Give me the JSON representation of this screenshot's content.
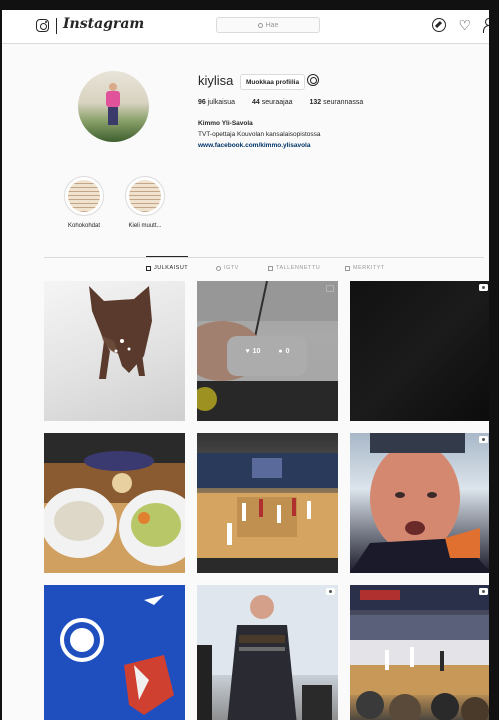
{
  "header": {
    "wordmark": "Instagram",
    "search_placeholder": "Hae"
  },
  "profile": {
    "username": "kiylisa",
    "edit_button": "Muokkaa profiilia",
    "posts_count": "96",
    "posts_label": "julkaisua",
    "followers_count": "44",
    "followers_label": "seuraajaa",
    "following_count": "132",
    "following_label": "seurannassa",
    "full_name": "Kimmo Yli-Savola",
    "bio": "TVT-opettaja Kouvolan kansalaisopistossa",
    "link": "www.facebook.com/kimmo.ylisavola"
  },
  "highlights": [
    {
      "label": "Kohokohdat"
    },
    {
      "label": "Kieli muutt..."
    }
  ],
  "tabs": [
    {
      "label": "JULKAISUT",
      "active": true
    },
    {
      "label": "IGTV",
      "active": false
    },
    {
      "label": "TALLENNETTU",
      "active": false
    },
    {
      "label": "MERKITYT",
      "active": false
    }
  ],
  "hover_post": {
    "likes": "10",
    "comments": "0"
  },
  "colors": {
    "link": "#003569",
    "border": "#dbdbdb",
    "background": "#fafafa"
  }
}
